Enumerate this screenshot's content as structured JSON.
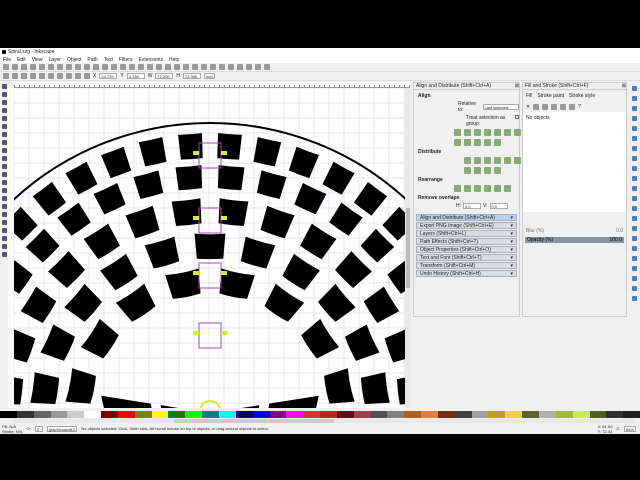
{
  "window": {
    "title": "Spiral.svg - Inkscape"
  },
  "menu": [
    "File",
    "Edit",
    "View",
    "Layer",
    "Object",
    "Path",
    "Text",
    "Filters",
    "Extensions",
    "Help"
  ],
  "tool_controls": {
    "x": "24.729",
    "y": "4.135",
    "w_label": "W",
    "w": "72.000",
    "h_label": "H",
    "h": "72.000",
    "unit": "mm"
  },
  "align_panel": {
    "title": "Align and Distribute (Shift+Ctrl+A)",
    "align_label": "Align",
    "relative_to_label": "Relative to:",
    "relative_to": "Last selected",
    "treat_group": "Treat selection as group:",
    "distribute_label": "Distribute",
    "rearrange_label": "Rearrange",
    "remove_overlaps_label": "Remove overlaps",
    "h_label": "H:",
    "h_value": "0.0",
    "v_label": "V:",
    "v_value": "0.0"
  },
  "docked": [
    "Align and Distribute (Shift+Ctrl+A)",
    "Export PNG Image (Shift+Ctrl+E)",
    "Layers (Shift+Ctrl+L)",
    "Path Effects (Shift+Ctrl+7)",
    "Object Properties (Shift+Ctrl+O)",
    "Text and Font (Shift+Ctrl+T)",
    "Transform (Shift+Ctrl+M)",
    "Undo History (Shift+Ctrl+H)"
  ],
  "fill_panel": {
    "title": "Fill and Stroke (Shift+Ctrl+F)",
    "tabs": [
      "Fill",
      "Stroke paint",
      "Stroke style"
    ],
    "no_objects": "No objects",
    "blur_label": "Blur (%)",
    "blur": "0.0",
    "opacity_label": "Opacity (%)",
    "opacity": "100.0"
  },
  "status": {
    "fill_label": "Fill:",
    "fill": "N/A",
    "stroke_label": "Stroke:",
    "stroke": "N/A",
    "opacity": "0",
    "layer": "graphicsdraft-0",
    "message": "No objects selected. Click, Shift+click, Alt+scroll mouse on top of objects, or drag around objects to select.",
    "x_label": "X:",
    "x": "61.00",
    "y_label": "Y:",
    "y": "72.43",
    "zoom_label": "Z:",
    "zoom": "64%"
  },
  "palette": [
    "#000000",
    "#333333",
    "#666666",
    "#999999",
    "#cccccc",
    "#ffffff",
    "#800000",
    "#ff0000",
    "#808000",
    "#ffff00",
    "#008000",
    "#00ff00",
    "#008080",
    "#00ffff",
    "#000080",
    "#0000ff",
    "#800080",
    "#ff00ff",
    "#e03030",
    "#c02020",
    "#601010",
    "#a04050",
    "#505050",
    "#808080",
    "#b06020",
    "#e08040",
    "#703010",
    "#404040",
    "#a0a0a0",
    "#c0a020",
    "#f0d040",
    "#606030",
    "#b0b0b0",
    "#a0c020",
    "#d0f040",
    "#506020",
    "#303030",
    "#202020"
  ]
}
